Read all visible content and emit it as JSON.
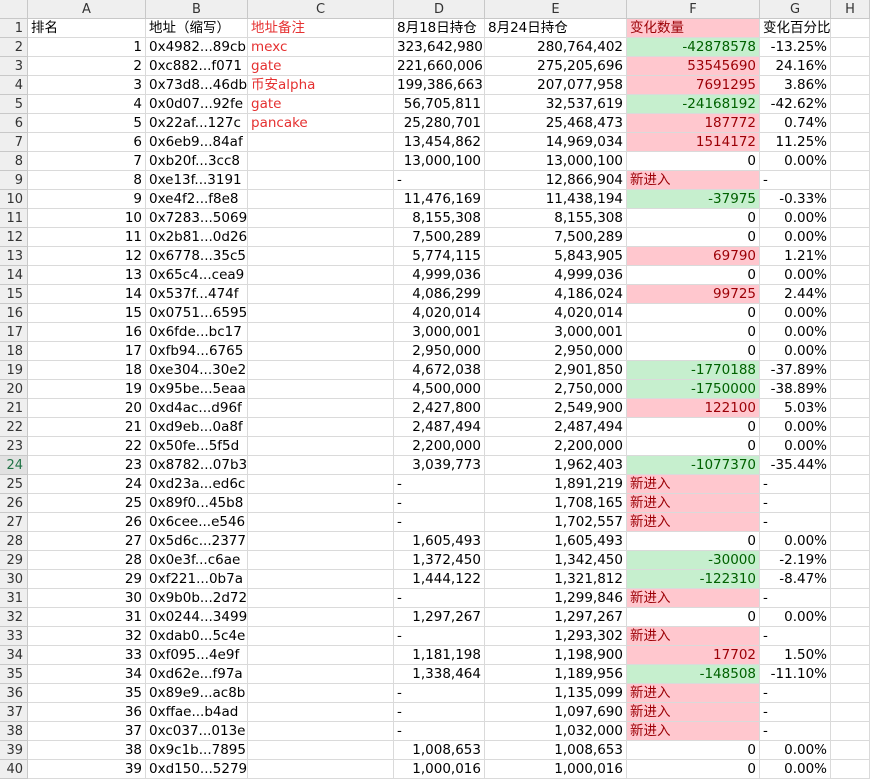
{
  "columns": [
    "A",
    "B",
    "C",
    "D",
    "E",
    "F",
    "G",
    "H"
  ],
  "header": {
    "row_num": "1",
    "rank": "排名",
    "address": "地址（缩写）",
    "note": "地址备注",
    "d18": "8月18日持仓",
    "d24": "8月24日持仓",
    "change": "变化数量",
    "pct": "变化百分比"
  },
  "rows": [
    {
      "n": "2",
      "rank": "1",
      "addr": "0x4982...89cb",
      "note": "mexc",
      "d18": "323,642,980",
      "d24": "280,764,402",
      "chg": "-42878578",
      "pct": "-13.25%",
      "t": "down"
    },
    {
      "n": "3",
      "rank": "2",
      "addr": "0xc882...f071",
      "note": "gate",
      "d18": "221,660,006",
      "d24": "275,205,696",
      "chg": "53545690",
      "pct": "24.16%",
      "t": "up"
    },
    {
      "n": "4",
      "rank": "3",
      "addr": "0x73d8...46db",
      "note": "币安alpha",
      "d18": "199,386,663",
      "d24": "207,077,958",
      "chg": "7691295",
      "pct": "3.86%",
      "t": "up"
    },
    {
      "n": "5",
      "rank": "4",
      "addr": "0x0d07...92fe",
      "note": "gate",
      "d18": "56,705,811",
      "d24": "32,537,619",
      "chg": "-24168192",
      "pct": "-42.62%",
      "t": "down"
    },
    {
      "n": "6",
      "rank": "5",
      "addr": "0x22af...127c",
      "note": "pancake",
      "d18": "25,280,701",
      "d24": "25,468,473",
      "chg": "187772",
      "pct": "0.74%",
      "t": "up"
    },
    {
      "n": "7",
      "rank": "6",
      "addr": "0x6eb9...84af",
      "note": "",
      "d18": "13,454,862",
      "d24": "14,969,034",
      "chg": "1514172",
      "pct": "11.25%",
      "t": "up"
    },
    {
      "n": "8",
      "rank": "7",
      "addr": "0xb20f...3cc8",
      "note": "",
      "d18": "13,000,100",
      "d24": "13,000,100",
      "chg": "0",
      "pct": "0.00%",
      "t": "none"
    },
    {
      "n": "9",
      "rank": "8",
      "addr": "0xe13f...3191",
      "note": "",
      "d18": "-",
      "d24": "12,866,904",
      "chg": "新进入",
      "pct": "-",
      "t": "new"
    },
    {
      "n": "10",
      "rank": "9",
      "addr": "0xe4f2...f8e8",
      "note": "",
      "d18": "11,476,169",
      "d24": "11,438,194",
      "chg": "-37975",
      "pct": "-0.33%",
      "t": "down"
    },
    {
      "n": "11",
      "rank": "10",
      "addr": "0x7283...5069",
      "note": "",
      "d18": "8,155,308",
      "d24": "8,155,308",
      "chg": "0",
      "pct": "0.00%",
      "t": "none"
    },
    {
      "n": "12",
      "rank": "11",
      "addr": "0x2b81...0d26",
      "note": "",
      "d18": "7,500,289",
      "d24": "7,500,289",
      "chg": "0",
      "pct": "0.00%",
      "t": "none"
    },
    {
      "n": "13",
      "rank": "12",
      "addr": "0x6778...35c5",
      "note": "",
      "d18": "5,774,115",
      "d24": "5,843,905",
      "chg": "69790",
      "pct": "1.21%",
      "t": "up"
    },
    {
      "n": "14",
      "rank": "13",
      "addr": "0x65c4...cea9",
      "note": "",
      "d18": "4,999,036",
      "d24": "4,999,036",
      "chg": "0",
      "pct": "0.00%",
      "t": "none"
    },
    {
      "n": "15",
      "rank": "14",
      "addr": "0x537f...474f",
      "note": "",
      "d18": "4,086,299",
      "d24": "4,186,024",
      "chg": "99725",
      "pct": "2.44%",
      "t": "up"
    },
    {
      "n": "16",
      "rank": "15",
      "addr": "0x0751...6595",
      "note": "",
      "d18": "4,020,014",
      "d24": "4,020,014",
      "chg": "0",
      "pct": "0.00%",
      "t": "none"
    },
    {
      "n": "17",
      "rank": "16",
      "addr": "0x6fde...bc17",
      "note": "",
      "d18": "3,000,001",
      "d24": "3,000,001",
      "chg": "0",
      "pct": "0.00%",
      "t": "none"
    },
    {
      "n": "18",
      "rank": "17",
      "addr": "0xfb94...6765",
      "note": "",
      "d18": "2,950,000",
      "d24": "2,950,000",
      "chg": "0",
      "pct": "0.00%",
      "t": "none"
    },
    {
      "n": "19",
      "rank": "18",
      "addr": "0xe304...30e2",
      "note": "",
      "d18": "4,672,038",
      "d24": "2,901,850",
      "chg": "-1770188",
      "pct": "-37.89%",
      "t": "down"
    },
    {
      "n": "20",
      "rank": "19",
      "addr": "0x95be...5eaa",
      "note": "",
      "d18": "4,500,000",
      "d24": "2,750,000",
      "chg": "-1750000",
      "pct": "-38.89%",
      "t": "down"
    },
    {
      "n": "21",
      "rank": "20",
      "addr": "0xd4ac...d96f",
      "note": "",
      "d18": "2,427,800",
      "d24": "2,549,900",
      "chg": "122100",
      "pct": "5.03%",
      "t": "up"
    },
    {
      "n": "22",
      "rank": "21",
      "addr": "0xd9eb...0a8f",
      "note": "",
      "d18": "2,487,494",
      "d24": "2,487,494",
      "chg": "0",
      "pct": "0.00%",
      "t": "none"
    },
    {
      "n": "23",
      "rank": "22",
      "addr": "0x50fe...5f5d",
      "note": "",
      "d18": "2,200,000",
      "d24": "2,200,000",
      "chg": "0",
      "pct": "0.00%",
      "t": "none"
    },
    {
      "n": "24",
      "rank": "23",
      "addr": "0x8782...07b3",
      "note": "",
      "d18": "3,039,773",
      "d24": "1,962,403",
      "chg": "-1077370",
      "pct": "-35.44%",
      "t": "down",
      "sel": true
    },
    {
      "n": "25",
      "rank": "24",
      "addr": "0xd23a...ed6c",
      "note": "",
      "d18": "-",
      "d24": "1,891,219",
      "chg": "新进入",
      "pct": "-",
      "t": "new"
    },
    {
      "n": "26",
      "rank": "25",
      "addr": "0x89f0...45b8",
      "note": "",
      "d18": "-",
      "d24": "1,708,165",
      "chg": "新进入",
      "pct": "-",
      "t": "new"
    },
    {
      "n": "27",
      "rank": "26",
      "addr": "0x6cee...e546",
      "note": "",
      "d18": "-",
      "d24": "1,702,557",
      "chg": "新进入",
      "pct": "-",
      "t": "new"
    },
    {
      "n": "28",
      "rank": "27",
      "addr": "0x5d6c...2377",
      "note": "",
      "d18": "1,605,493",
      "d24": "1,605,493",
      "chg": "0",
      "pct": "0.00%",
      "t": "none"
    },
    {
      "n": "29",
      "rank": "28",
      "addr": "0x0e3f...c6ae",
      "note": "",
      "d18": "1,372,450",
      "d24": "1,342,450",
      "chg": "-30000",
      "pct": "-2.19%",
      "t": "down"
    },
    {
      "n": "30",
      "rank": "29",
      "addr": "0xf221...0b7a",
      "note": "",
      "d18": "1,444,122",
      "d24": "1,321,812",
      "chg": "-122310",
      "pct": "-8.47%",
      "t": "down"
    },
    {
      "n": "31",
      "rank": "30",
      "addr": "0x9b0b...2d72",
      "note": "",
      "d18": "-",
      "d24": "1,299,846",
      "chg": "新进入",
      "pct": "-",
      "t": "new"
    },
    {
      "n": "32",
      "rank": "31",
      "addr": "0x0244...3499",
      "note": "",
      "d18": "1,297,267",
      "d24": "1,297,267",
      "chg": "0",
      "pct": "0.00%",
      "t": "none"
    },
    {
      "n": "33",
      "rank": "32",
      "addr": "0xdab0...5c4e",
      "note": "",
      "d18": "-",
      "d24": "1,293,302",
      "chg": "新进入",
      "pct": "-",
      "t": "new"
    },
    {
      "n": "34",
      "rank": "33",
      "addr": "0xf095...4e9f",
      "note": "",
      "d18": "1,181,198",
      "d24": "1,198,900",
      "chg": "17702",
      "pct": "1.50%",
      "t": "up"
    },
    {
      "n": "35",
      "rank": "34",
      "addr": "0xd62e...f97a",
      "note": "",
      "d18": "1,338,464",
      "d24": "1,189,956",
      "chg": "-148508",
      "pct": "-11.10%",
      "t": "down"
    },
    {
      "n": "36",
      "rank": "35",
      "addr": "0x89e9...ac8b",
      "note": "",
      "d18": "-",
      "d24": "1,135,099",
      "chg": "新进入",
      "pct": "-",
      "t": "new"
    },
    {
      "n": "37",
      "rank": "36",
      "addr": "0xffae...b4ad",
      "note": "",
      "d18": "-",
      "d24": "1,097,690",
      "chg": "新进入",
      "pct": "-",
      "t": "new"
    },
    {
      "n": "38",
      "rank": "37",
      "addr": "0xc037...013e",
      "note": "",
      "d18": "-",
      "d24": "1,032,000",
      "chg": "新进入",
      "pct": "-",
      "t": "new"
    },
    {
      "n": "39",
      "rank": "38",
      "addr": "0x9c1b...7895",
      "note": "",
      "d18": "1,008,653",
      "d24": "1,008,653",
      "chg": "0",
      "pct": "0.00%",
      "t": "none"
    },
    {
      "n": "40",
      "rank": "39",
      "addr": "0xd150...5279",
      "note": "",
      "d18": "1,000,016",
      "d24": "1,000,016",
      "chg": "0",
      "pct": "0.00%",
      "t": "none"
    }
  ],
  "colors": {
    "header_bg": "#efefef",
    "grid": "#dadada",
    "up_fill": "#ffc7ce",
    "up_text": "#9c0006",
    "down_fill": "#c6efce",
    "down_text": "#006100",
    "note_text": "#e53030"
  }
}
